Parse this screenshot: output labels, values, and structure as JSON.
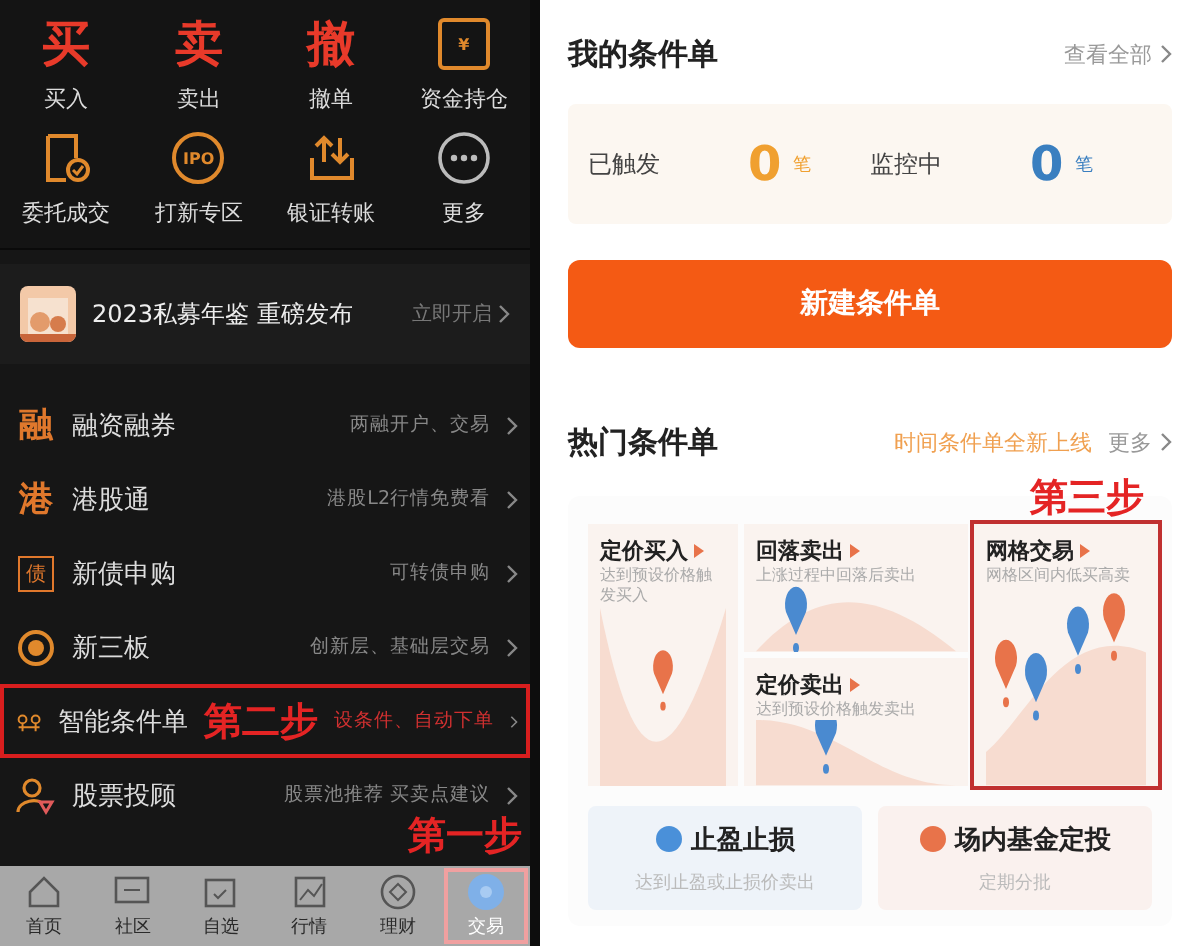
{
  "trade_panel": {
    "quick_actions": [
      {
        "label": "买入",
        "kind": "glyph",
        "glyph": "买"
      },
      {
        "label": "卖出",
        "kind": "glyph",
        "glyph": "卖"
      },
      {
        "label": "撤单",
        "kind": "glyph",
        "glyph": "撤"
      },
      {
        "label": "资金持仓",
        "kind": "house",
        "badge": "¥"
      },
      {
        "label": "委托成交",
        "kind": "doc"
      },
      {
        "label": "打新专区",
        "kind": "badge",
        "badge": "IPO"
      },
      {
        "label": "银证转账",
        "kind": "transfer"
      },
      {
        "label": "更多",
        "kind": "more"
      }
    ],
    "banner": {
      "title": "2023私募年鉴 重磅发布",
      "action": "立即开启"
    },
    "menu": [
      {
        "label": "融资融券",
        "hint": "两融开户、交易",
        "kind": "glyph",
        "glyph": "融"
      },
      {
        "label": "港股通",
        "hint": "港股L2行情免费看",
        "kind": "glyph",
        "glyph": "港"
      },
      {
        "label": "新债申购",
        "hint": "可转债申购",
        "kind": "boxed",
        "glyph": "债"
      },
      {
        "label": "新三板",
        "hint": "创新层、基础层交易",
        "kind": "ring"
      },
      {
        "label": "智能条件单",
        "hint": "设条件、自动下单",
        "kind": "chip",
        "outlined": true,
        "annotation": "第二步"
      },
      {
        "label": "股票投顾",
        "hint": "股票池推荐 买卖点建议",
        "kind": "person"
      }
    ],
    "tab_bar": [
      {
        "label": "首页",
        "kind": "home",
        "selected": false
      },
      {
        "label": "社区",
        "kind": "chat",
        "selected": false
      },
      {
        "label": "自选",
        "kind": "calendar",
        "selected": false
      },
      {
        "label": "行情",
        "kind": "chart",
        "selected": false
      },
      {
        "label": "理财",
        "kind": "diamond",
        "selected": false
      },
      {
        "label": "交易",
        "kind": "trade",
        "selected": true,
        "outlined": true,
        "annotation": "第一步"
      }
    ]
  },
  "condition_panel": {
    "my_orders": {
      "title": "我的条件单",
      "view_all": "查看全部",
      "stats": [
        {
          "label": "已触发",
          "count": "0",
          "unit": "笔",
          "color": "#f0a030"
        },
        {
          "label": "监控中",
          "count": "0",
          "unit": "笔",
          "color": "#3a7fc0"
        }
      ]
    },
    "create_button": "新建条件单",
    "popular": {
      "title": "热门条件单",
      "promo": "时间条件单全新上线",
      "more": "更多",
      "strategies": [
        {
          "title": "定价买入",
          "desc": "达到预设价格触发买入",
          "kind": "valley"
        },
        {
          "title": "回落卖出",
          "desc": "上涨过程中回落后卖出",
          "kind": "peak"
        },
        {
          "title": "定价卖出",
          "desc": "达到预设价格触发卖出",
          "kind": "slope"
        },
        {
          "title": "网格交易",
          "desc": "网格区间内低买高卖",
          "kind": "grid",
          "outlined": true,
          "annotation": "第三步"
        }
      ],
      "tools": [
        {
          "title": "止盈止损",
          "desc": "达到止盈或止损价卖出",
          "color": "#4a90d9"
        },
        {
          "title": "场内基金定投",
          "desc": "定期分批",
          "color": "#e8734a"
        }
      ]
    }
  }
}
